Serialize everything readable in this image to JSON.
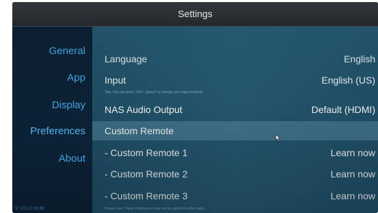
{
  "window": {
    "title": "Settings"
  },
  "sidebar": {
    "items": [
      {
        "label": "General"
      },
      {
        "label": "App"
      },
      {
        "label": "Display"
      },
      {
        "label": "Preferences"
      },
      {
        "label": "About"
      }
    ],
    "version": "V: 172.17.20.66"
  },
  "settings": {
    "language": {
      "label": "Language",
      "value": "English"
    },
    "input": {
      "label": "Input",
      "value": "English (US)",
      "hint": "Tips: You can press \"Ctrl + Space\" to change your input methods."
    },
    "nas_audio": {
      "label": "NAS Audio Output",
      "value": "Default (HDMI)"
    },
    "custom_remote": {
      "label": "Custom Remote"
    },
    "remotes": [
      {
        "label": "- Custom Remote 1",
        "action": "Learn now"
      },
      {
        "label": "- Custom Remote 2",
        "action": "Learn now"
      },
      {
        "label": "- Custom Remote 3",
        "action": "Learn now"
      }
    ],
    "footer_note": "Please note: These Preferences may not be applied to other apps."
  }
}
